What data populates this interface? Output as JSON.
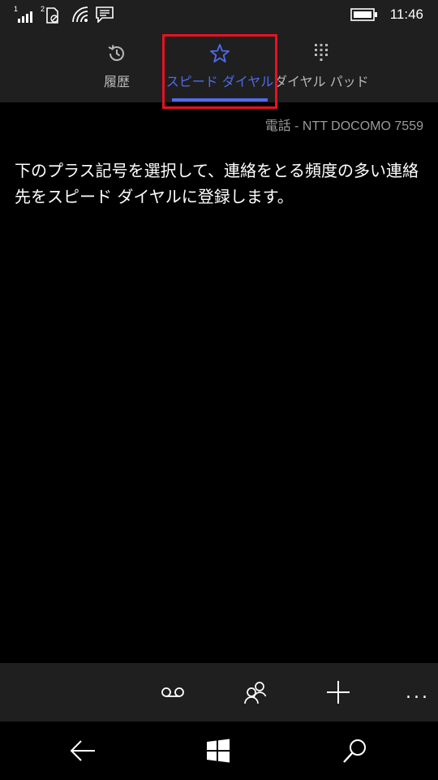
{
  "status_bar": {
    "sim1_label": "1",
    "sim2_label": "2",
    "time": "11:46",
    "icons": [
      "signal-bars-icon",
      "sim-no-signal-icon",
      "wifi-icon",
      "message-icon",
      "battery-icon"
    ]
  },
  "tabs": [
    {
      "label": "履歴",
      "icon": "history-icon",
      "active": false
    },
    {
      "label": "スピード ダイヤル",
      "icon": "star-icon",
      "active": true
    },
    {
      "label": "ダイヤル パッド",
      "icon": "dialpad-icon",
      "active": false
    }
  ],
  "carrier": "電話 - NTT DOCOMO 7559",
  "empty_message": "下のプラス記号を選択して、連絡をとる頻度の多い連絡先をスピード ダイヤルに登録します。",
  "app_bar": {
    "buttons": [
      "voicemail-icon",
      "contacts-icon",
      "add-icon"
    ],
    "more": "..."
  },
  "nav_bar": {
    "buttons": [
      "back-icon",
      "windows-start-icon",
      "search-icon"
    ]
  },
  "colors": {
    "accent": "#4f6bed",
    "highlight": "#e81123",
    "bar_background": "#1f1f1f",
    "background": "#000000"
  }
}
